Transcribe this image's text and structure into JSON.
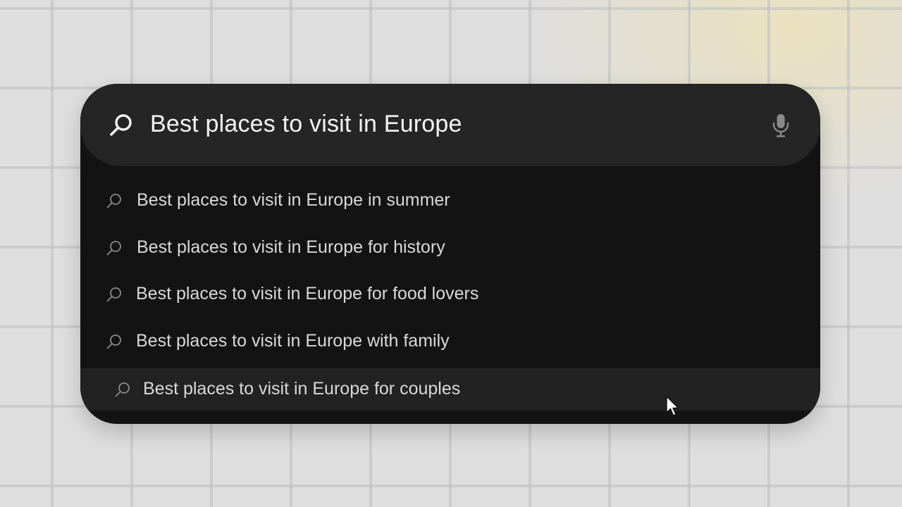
{
  "search": {
    "query": "Best places to visit in Europe",
    "search_icon": "search-icon",
    "mic_icon": "microphone-icon"
  },
  "suggestions": [
    {
      "label": "Best places to visit in Europe in summer",
      "icon": "search-icon"
    },
    {
      "label": "Best places to visit in Europe for history",
      "icon": "search-icon"
    },
    {
      "label": "Best places to visit in Europe for food lovers",
      "icon": "search-icon"
    },
    {
      "label": "Best places to visit in Europe with family",
      "icon": "search-icon"
    },
    {
      "label": "Best places to visit in Europe for couples",
      "icon": "search-icon",
      "highlighted": true
    }
  ],
  "colors": {
    "panel": "#131313",
    "search_bar": "#252525",
    "highlight_row": "#222222",
    "text_primary": "#f4f4f4",
    "text_suggestion": "#d9d9d9",
    "icon_muted": "#8a8a8a"
  },
  "cursor": "arrow-cursor-icon"
}
